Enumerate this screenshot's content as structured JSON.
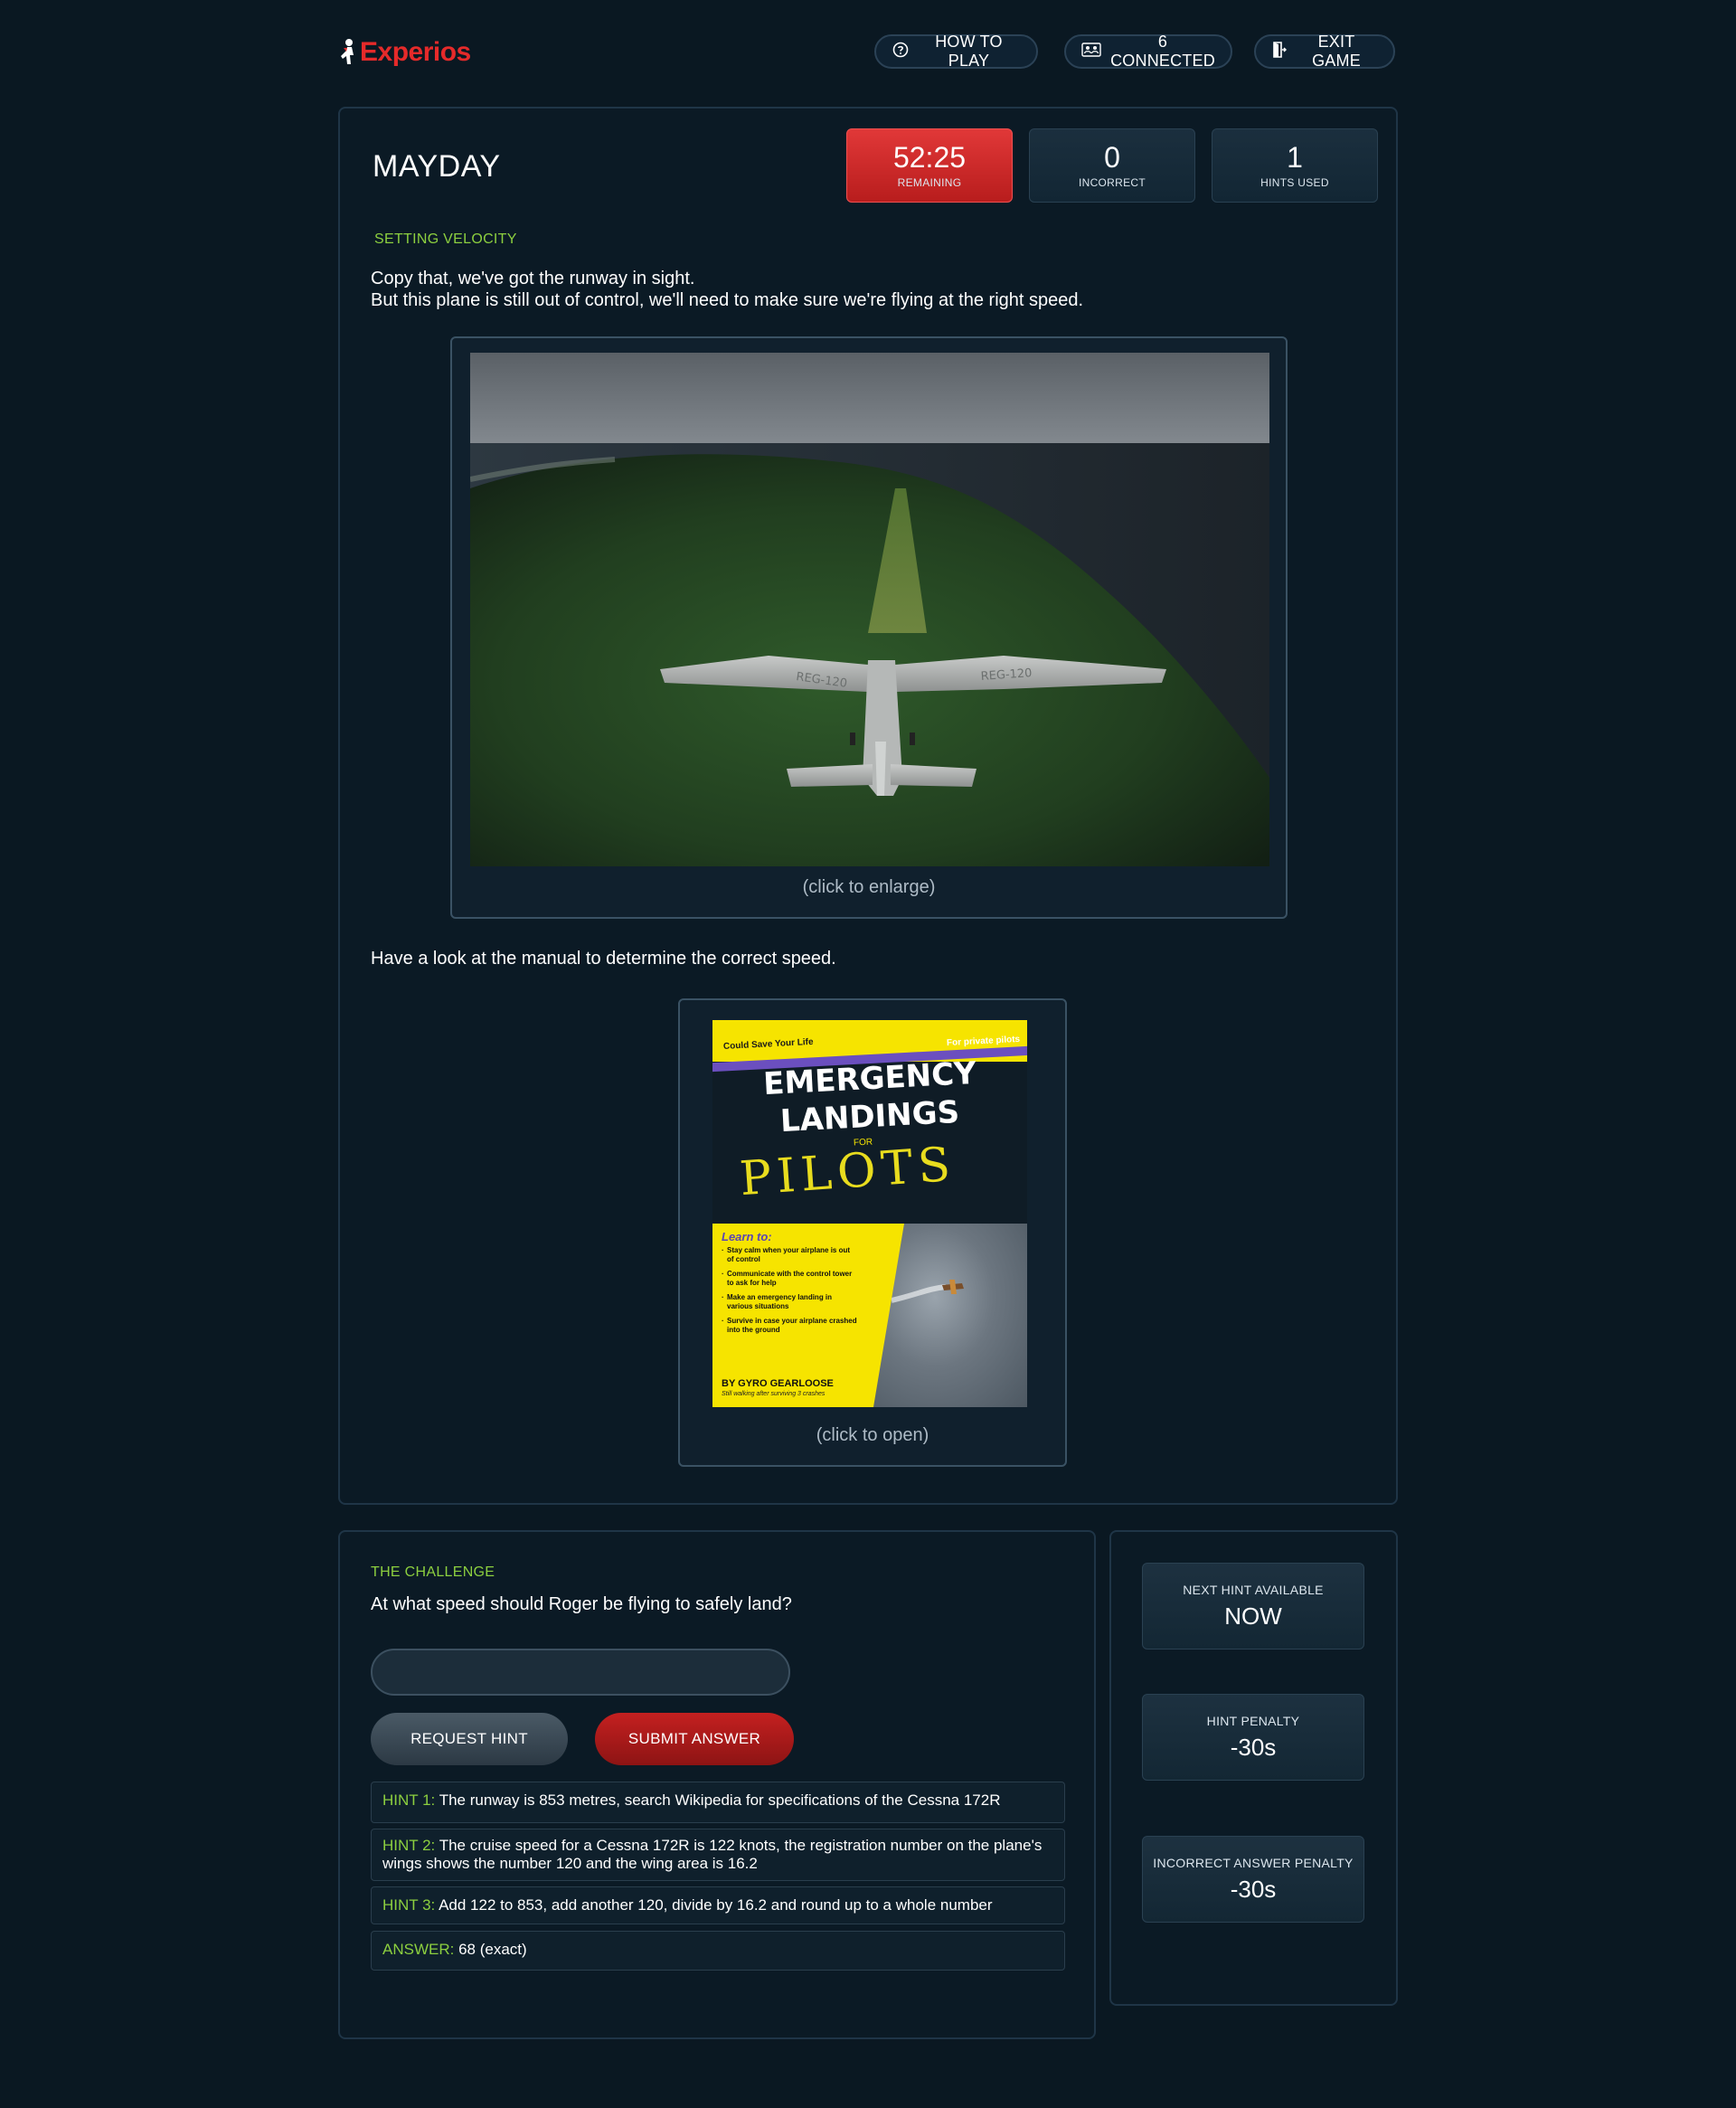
{
  "header": {
    "logo": "Experios",
    "how_to_play": "HOW TO PLAY",
    "connected": "6 CONNECTED",
    "exit_game": "EXIT GAME"
  },
  "game": {
    "title": "MAYDAY",
    "stats": {
      "time": "52:25",
      "time_label": "REMAINING",
      "incorrect": "0",
      "incorrect_label": "INCORRECT",
      "hints": "1",
      "hints_label": "HINTS USED"
    },
    "section_label": "SETTING VELOCITY",
    "intro_line1": "Copy that, we've got the runway in sight.",
    "intro_line2": "But this plane is still out of control, we'll need to make sure we're flying at the right speed.",
    "image_caption": "(click to enlarge)",
    "manual_text": "Have a look at the manual to determine the correct speed.",
    "manual_caption": "(click to open)",
    "plane_markings": "REG-120",
    "book": {
      "tagline": "Could Save Your Life",
      "for_private": "For private pilots",
      "title_line1": "EMERGENCY",
      "title_line2": "LANDINGS",
      "for": "FOR",
      "pilots": "PILOTS",
      "learn": "Learn to:",
      "items": [
        "Stay calm when your airplane is out of control",
        "Communicate with the control tower to ask for help",
        "Make an emergency landing in various situations",
        "Survive in case your airplane crashed into the ground"
      ],
      "author": "BY GYRO GEARLOOSE",
      "author_sub": "Still walking after surviving 3 crashes"
    }
  },
  "challenge": {
    "label": "THE CHALLENGE",
    "question": "At what speed should Roger be flying to safely land?",
    "input_value": "",
    "input_placeholder": "",
    "request_hint": "REQUEST HINT",
    "submit_answer": "SUBMIT ANSWER",
    "hints": [
      {
        "key": "HINT 1:",
        "text": "The runway is 853 metres, search Wikipedia for specifications of the Cessna 172R"
      },
      {
        "key": "HINT 2:",
        "text": "The cruise speed for a Cessna 172R is 122 knots, the registration number on the plane's wings shows the number 120 and the wing area is 16.2"
      },
      {
        "key": "HINT 3:",
        "text": "Add 122 to 853, add another 120, divide by 16.2 and round up to a whole number"
      },
      {
        "key": "ANSWER:",
        "text": "68 (exact)"
      }
    ]
  },
  "side": {
    "next_hint_label": "NEXT HINT AVAILABLE",
    "next_hint_value": "NOW",
    "hint_penalty_label": "HINT PENALTY",
    "hint_penalty_value": "-30s",
    "incorrect_penalty_label": "INCORRECT ANSWER PENALTY",
    "incorrect_penalty_value": "-30s"
  },
  "colors": {
    "background": "#0a1822",
    "brand_red": "#e52a2a",
    "accent_green": "#8ccf3f",
    "timer_red": "#d42e2e",
    "book_yellow": "#f6e400"
  },
  "icons": [
    "question-circle-icon",
    "connected-users-icon",
    "exit-door-icon",
    "logo-figure-icon"
  ]
}
